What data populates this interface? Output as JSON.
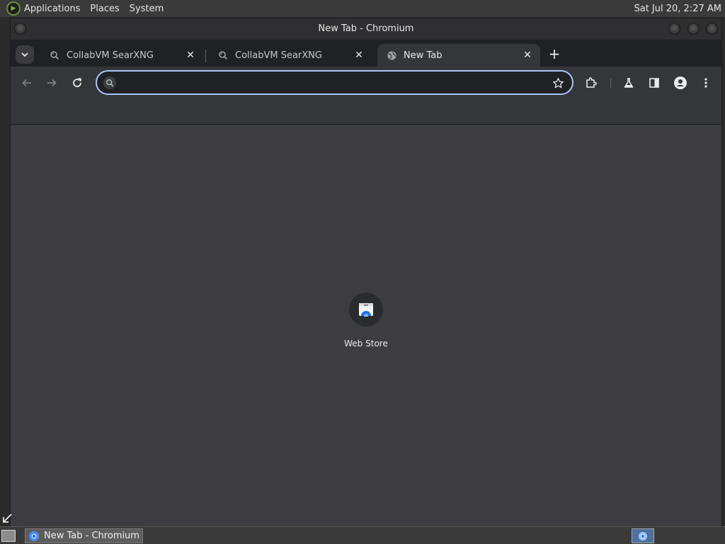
{
  "top_panel": {
    "menus": [
      "Applications",
      "Places",
      "System"
    ],
    "clock": "Sat Jul 20,  2:27 AM"
  },
  "window": {
    "title": "New Tab - Chromium"
  },
  "tabs": [
    {
      "label": "CollabVM SearXNG",
      "icon": "searxng-icon",
      "active": false
    },
    {
      "label": "CollabVM SearXNG",
      "icon": "searxng-icon",
      "active": false
    },
    {
      "label": "New Tab",
      "icon": "globe-icon",
      "active": true
    }
  ],
  "omnibox": {
    "value": "",
    "placeholder": ""
  },
  "toolbar_icons": [
    "back-icon",
    "forward-icon",
    "reload-icon",
    "star-icon",
    "extensions-icon",
    "labs-icon",
    "side-panel-icon",
    "profile-icon",
    "menu-icon"
  ],
  "shortcuts": [
    {
      "label": "Web Store",
      "icon": "web-store-icon"
    }
  ],
  "taskbar": {
    "task_label": "New Tab - Chromium"
  },
  "colors": {
    "accent": "#a8c7fa",
    "content_bg": "#3c3c41",
    "tabstrip_bg": "#202124"
  }
}
